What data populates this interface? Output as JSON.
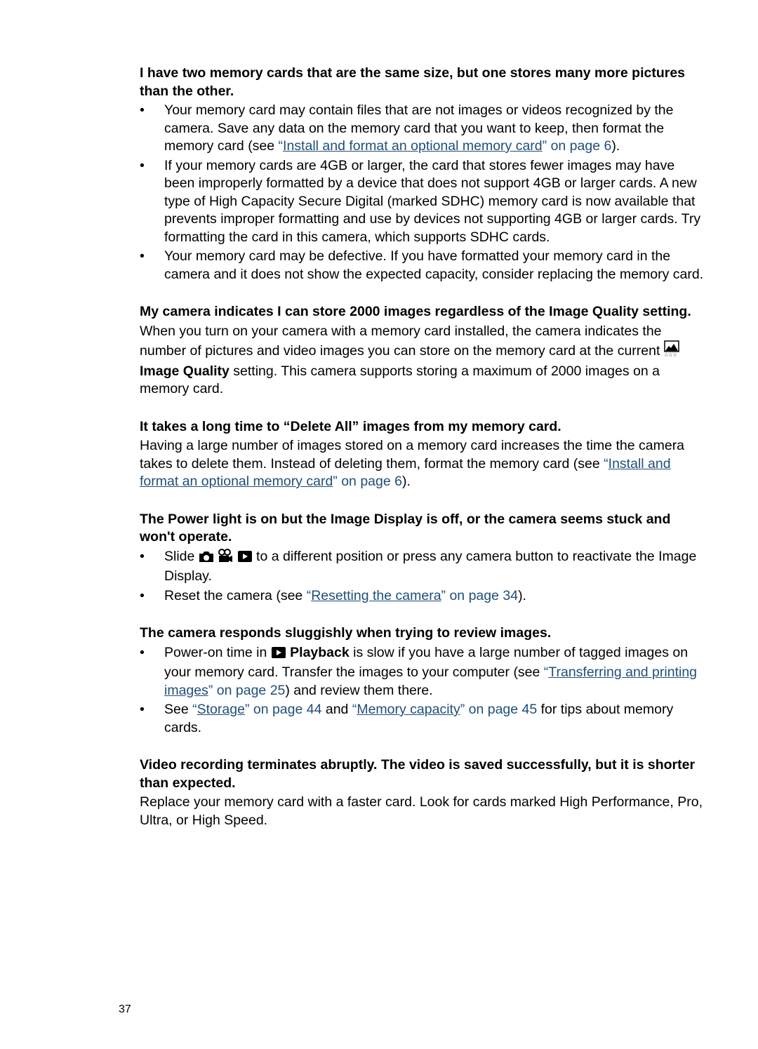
{
  "sections": [
    {
      "heading": "I have two memory cards that are the same size, but one stores many more pictures than the other.",
      "bullets": [
        {
          "before": "Your memory card may contain files that are not images or videos recognized by the camera. Save any data on the memory card that you want to keep, then format the memory card (see ",
          "link_open": "“",
          "link": "Install and format an optional memory card",
          "link_close": "” on page 6",
          "after": ")."
        },
        {
          "text": "If your memory cards are 4GB or larger, the card that stores fewer images may have been improperly formatted by a device that does not support 4GB or larger cards. A new type of High Capacity Secure Digital (marked SDHC) memory card is now available that prevents improper formatting and use by devices not supporting 4GB or larger cards. Try formatting the card in this camera, which supports SDHC cards."
        },
        {
          "text": "Your memory card may be defective. If you have formatted your memory card in the camera and it does not show the expected capacity, consider replacing the memory card."
        }
      ]
    },
    {
      "heading": "My camera indicates I can store 2000 images regardless of the Image Quality setting.",
      "para_before": "When you turn on your camera with a memory card installed, the camera indicates the number of pictures and video images you can store on the memory card at the current ",
      "para_icon": "image-quality-icon",
      "para_bold": "Image Quality",
      "para_after": " setting. This camera supports storing a maximum of 2000 images on a memory card."
    },
    {
      "heading": "It takes a long time to “Delete All” images from my memory card.",
      "para_before": "Having a large number of images stored on a memory card increases the time the camera takes to delete them. Instead of deleting them, format the memory card (see ",
      "link_open": "“",
      "link": "Install and format an optional memory card",
      "link_close": "” on page 6",
      "para_after": ")."
    },
    {
      "heading": "The Power light is on but the Image Display is off, or the camera seems stuck and won't operate.",
      "bullets": [
        {
          "before": "Slide ",
          "icons": [
            "camera-icon",
            "video-camera-icon",
            "playback-icon"
          ],
          "after": " to a different position or press any camera button to reactivate the Image Display."
        },
        {
          "before": "Reset the camera (see ",
          "link_open": "“",
          "link": "Resetting the camera",
          "link_close": "” on page 34",
          "after": ")."
        }
      ]
    },
    {
      "heading": "The camera responds sluggishly when trying to review images.",
      "bullets": [
        {
          "before": "Power-on time in ",
          "icon": "playback-icon",
          "bold": "Playback",
          "mid": " is slow if you have a large number of tagged images on your memory card. Transfer the images to your computer (see ",
          "link_open": "“",
          "link": "Transferring and printing images",
          "link_close": "” on page 25",
          "after": ") and review them there."
        },
        {
          "before": "See ",
          "link1_open": "“",
          "link1": "Storage",
          "link1_close": "” on page 44",
          "middle": " and ",
          "link2_open": "“",
          "link2": "Memory capacity",
          "link2_close": "” on page 45",
          "after": " for tips about memory cards."
        }
      ]
    },
    {
      "heading": "Video recording terminates abruptly. The video is saved successfully, but it is shorter than expected.",
      "para": "Replace your memory card with a faster card. Look for cards marked High Performance, Pro, Ultra, or High Speed."
    }
  ],
  "bullet_char": "•",
  "page_number": "37",
  "colors": {
    "link": "#1f4e79",
    "text": "#000000"
  }
}
